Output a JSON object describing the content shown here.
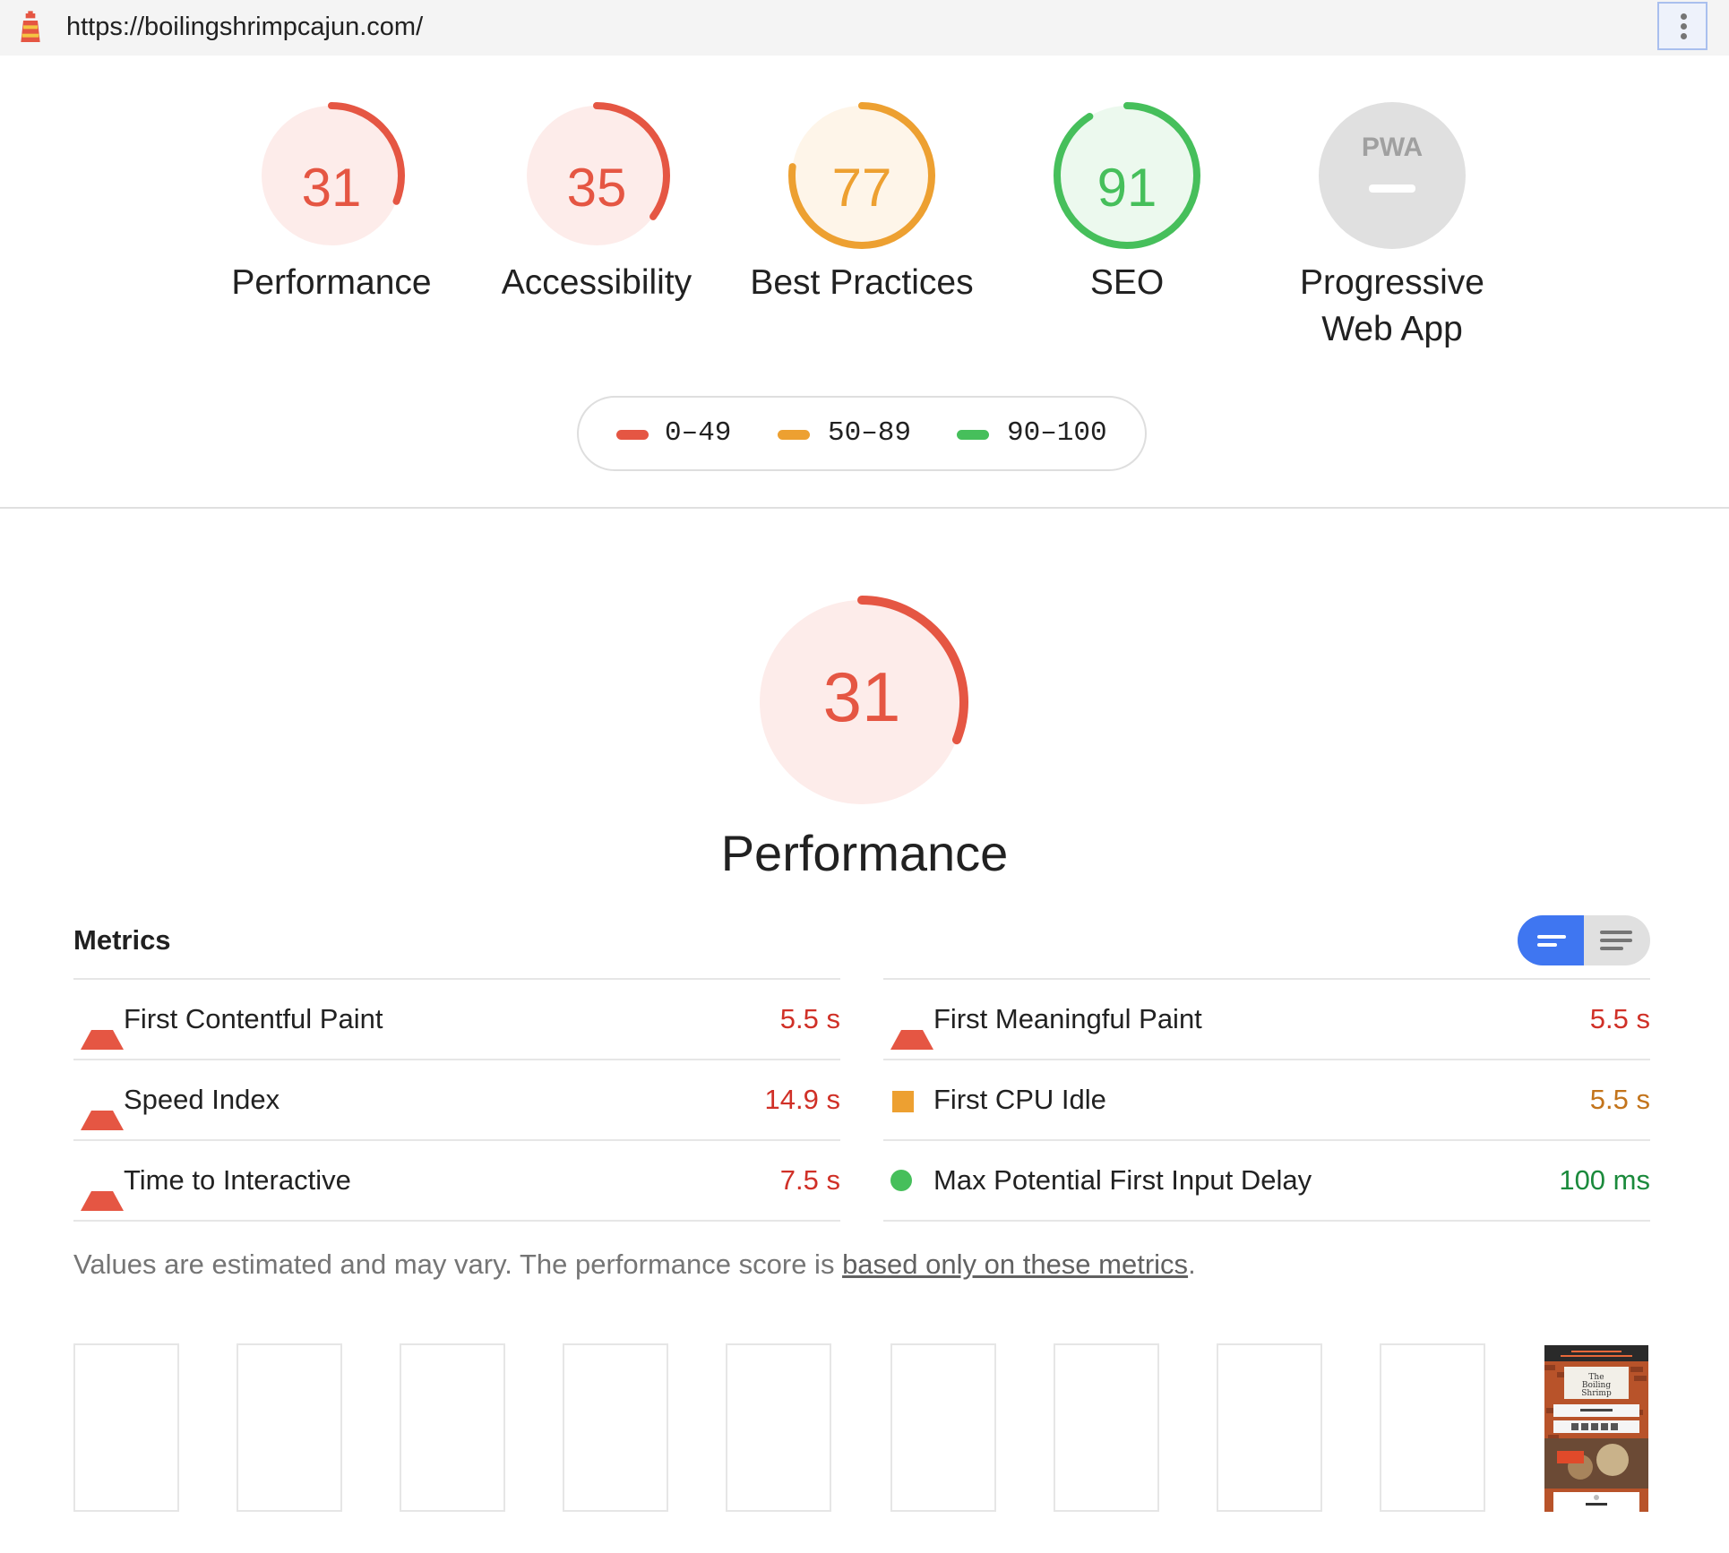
{
  "topbar": {
    "url": "https://boilingshrimpcajun.com/",
    "logo_icon": "lighthouse-icon",
    "menu_icon": "vertical-dots-icon"
  },
  "gauges": [
    {
      "label": "Performance",
      "score": "31",
      "fraction": 0.31,
      "rating": "fail"
    },
    {
      "label": "Accessibility",
      "score": "35",
      "fraction": 0.35,
      "rating": "fail"
    },
    {
      "label": "Best Practices",
      "score": "77",
      "fraction": 0.77,
      "rating": "average"
    },
    {
      "label": "SEO",
      "score": "91",
      "fraction": 0.91,
      "rating": "pass"
    },
    {
      "label": "Progressive\nWeb App",
      "score": "PWA",
      "rating": "na"
    }
  ],
  "legend": [
    {
      "range": "0–49",
      "color": "#e55643"
    },
    {
      "range": "50–89",
      "color": "#eda031"
    },
    {
      "range": "90–100",
      "color": "#46bf5b"
    }
  ],
  "performance": {
    "score": "31",
    "fraction": 0.31,
    "title": "Performance"
  },
  "metrics": {
    "title": "Metrics",
    "left": [
      {
        "name": "First Contentful Paint",
        "value": "5.5 s",
        "rating": "fail"
      },
      {
        "name": "Speed Index",
        "value": "14.9 s",
        "rating": "fail"
      },
      {
        "name": "Time to Interactive",
        "value": "7.5 s",
        "rating": "fail"
      }
    ],
    "right": [
      {
        "name": "First Meaningful Paint",
        "value": "5.5 s",
        "rating": "fail"
      },
      {
        "name": "First CPU Idle",
        "value": "5.5 s",
        "rating": "average"
      },
      {
        "name": "Max Potential First Input Delay",
        "value": "100 ms",
        "rating": "pass"
      }
    ],
    "note_prefix": "Values are estimated and may vary. The performance score is ",
    "note_link": "based only on these metrics",
    "note_suffix": "."
  },
  "colors": {
    "fail": "#e55643",
    "average": "#eda031",
    "pass": "#46bf5b",
    "toggle_active": "#3f76f1"
  }
}
